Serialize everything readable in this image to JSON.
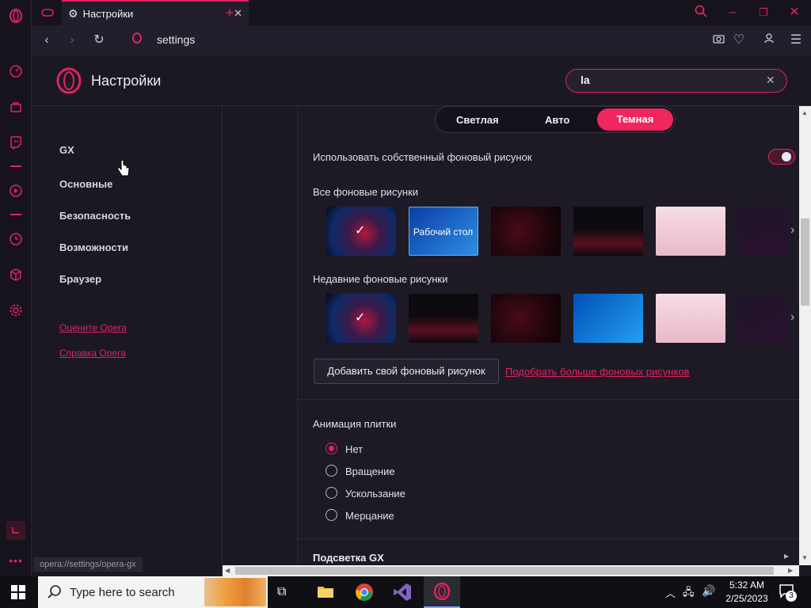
{
  "tab": {
    "title": "Настройки"
  },
  "address": {
    "url": "settings"
  },
  "header": {
    "title": "Настройки",
    "search_value": "la"
  },
  "nav": {
    "items": [
      "GX",
      "Основные",
      "Безопасность",
      "Возможности",
      "Браузер"
    ],
    "links": [
      "Оцените Opera",
      "Справка Opera"
    ]
  },
  "theme": {
    "options": [
      "Светлая",
      "Авто",
      "Темная"
    ],
    "selected": "Темная"
  },
  "wallpaper": {
    "custom_label": "Использовать собственный фоновый рисунок",
    "custom_enabled": true,
    "all_label": "Все фоновые рисунки",
    "recent_label": "Недавние фоновые рисунки",
    "desktop_label": "Рабочий стол",
    "add_button": "Добавить свой фоновый рисунок",
    "more_link": "Подобрать больше фоновых рисунков"
  },
  "animation": {
    "title": "Анимация плитки",
    "options": [
      "Нет",
      "Вращение",
      "Ускользание",
      "Мерцание"
    ],
    "selected": "Нет"
  },
  "gx_lighting": {
    "title": "Подсветка GX"
  },
  "status_bar": {
    "url": "opera://settings/opera-gx"
  },
  "taskbar": {
    "search_placeholder": "Type here to search",
    "time": "5:32 AM",
    "date": "2/25/2023",
    "notifications": "3"
  },
  "colors": {
    "accent": "#e0245e",
    "background": "#1b1824"
  }
}
